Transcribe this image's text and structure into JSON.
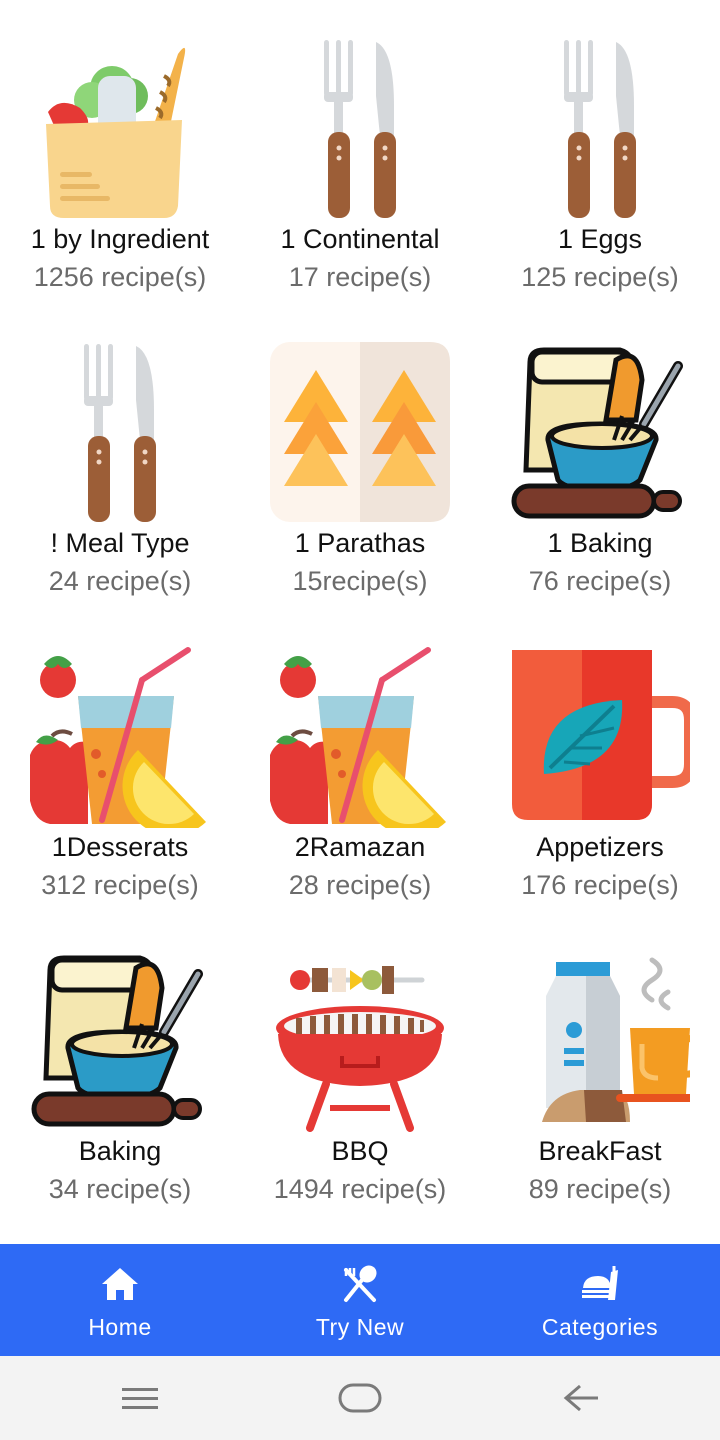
{
  "categories": [
    {
      "title": "1 by Ingredient",
      "count": "1256 recipe(s)",
      "icon": "grocery-bag-icon"
    },
    {
      "title": "1 Continental",
      "count": "17 recipe(s)",
      "icon": "fork-knife-icon"
    },
    {
      "title": "1 Eggs",
      "count": "125 recipe(s)",
      "icon": "fork-knife-icon"
    },
    {
      "title": "! Meal Type",
      "count": "24 recipe(s)",
      "icon": "fork-knife-icon"
    },
    {
      "title": "1 Parathas",
      "count": "15recipe(s)",
      "icon": "parathas-photo-icon"
    },
    {
      "title": "1 Baking",
      "count": "76 recipe(s)",
      "icon": "baking-bowl-icon"
    },
    {
      "title": "1Desserats",
      "count": "312 recipe(s)",
      "icon": "juice-glass-icon"
    },
    {
      "title": "2Ramazan",
      "count": "28 recipe(s)",
      "icon": "juice-glass-icon"
    },
    {
      "title": "Appetizers",
      "count": "176 recipe(s)",
      "icon": "tea-mug-icon"
    },
    {
      "title": "Baking",
      "count": "34 recipe(s)",
      "icon": "baking-bowl-icon"
    },
    {
      "title": "BBQ",
      "count": "1494 recipe(s)",
      "icon": "bbq-grill-icon"
    },
    {
      "title": "BreakFast",
      "count": "89 recipe(s)",
      "icon": "breakfast-icon"
    }
  ],
  "bottom_nav": {
    "home": {
      "label": "Home",
      "icon": "home-icon"
    },
    "try_new": {
      "label": "Try New",
      "icon": "fork-spoon-icon"
    },
    "categories": {
      "label": "Categories",
      "icon": "food-tray-icon"
    }
  },
  "system_nav": {
    "menu": "menu-icon",
    "home": "home-pill-icon",
    "back": "back-arrow-icon"
  },
  "colors": {
    "bottom_nav_bg": "#2e6af5",
    "title_text": "#111111",
    "count_text": "#6b6b6b",
    "system_nav_bg": "#f3f3f3"
  }
}
